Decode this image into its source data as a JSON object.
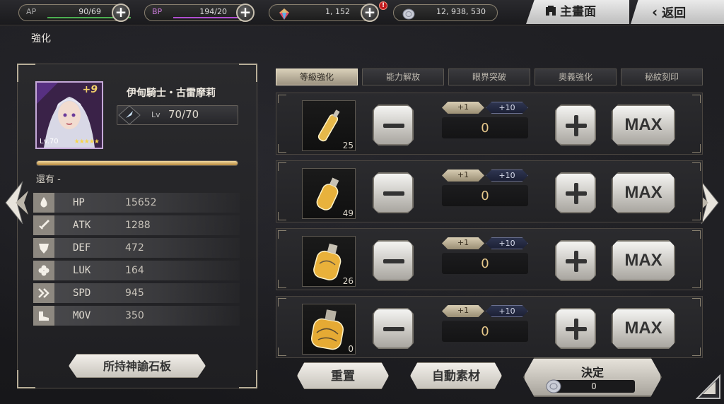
{
  "topbar": {
    "ap": {
      "label": "AP",
      "value": "90/69",
      "fill": 1.0
    },
    "bp": {
      "label": "BP",
      "value": "194/20",
      "fill": 1.0
    },
    "gems": {
      "value": "1, 152",
      "alert": "!"
    },
    "coins": {
      "value": "12, 938, 530"
    },
    "main_menu_label": "主畫面",
    "back_label": "返回"
  },
  "page_title": "強化",
  "unit": {
    "name": "伊甸騎士・古雷摩莉",
    "plus": "+9",
    "portrait_level": "Lv.70",
    "lv_prefix": "Lv",
    "level": "70/70",
    "stars": "★★★★★",
    "exp_fill": 1.0,
    "remain_label": "還有 -",
    "stats": [
      {
        "key": "HP",
        "value": "15652",
        "icon": "drop-icon"
      },
      {
        "key": "ATK",
        "value": "1288",
        "icon": "sword-icon"
      },
      {
        "key": "DEF",
        "value": "472",
        "icon": "shield-icon"
      },
      {
        "key": "LUK",
        "value": "164",
        "icon": "clover-icon"
      },
      {
        "key": "SPD",
        "value": "945",
        "icon": "speed-icon"
      },
      {
        "key": "MOV",
        "value": "350",
        "icon": "boot-icon"
      }
    ],
    "board_button_label": "所持神諭石板"
  },
  "tabs": [
    {
      "label": "等級強化",
      "active": true
    },
    {
      "label": "能力解放",
      "active": false
    },
    {
      "label": "眼界突破",
      "active": false
    },
    {
      "label": "奧義強化",
      "active": false
    },
    {
      "label": "秘紋刻印",
      "active": false
    }
  ],
  "items": [
    {
      "name": "exp-vial-small",
      "count": "25",
      "quantity": "0",
      "step1": "+1",
      "step10": "+10",
      "max_label": "MAX"
    },
    {
      "name": "exp-vial-medium",
      "count": "49",
      "quantity": "0",
      "step1": "+1",
      "step10": "+10",
      "max_label": "MAX"
    },
    {
      "name": "exp-vial-large",
      "count": "26",
      "quantity": "0",
      "step1": "+1",
      "step10": "+10",
      "max_label": "MAX"
    },
    {
      "name": "exp-vial-xlarge",
      "count": "0",
      "quantity": "0",
      "step1": "+1",
      "step10": "+10",
      "max_label": "MAX"
    }
  ],
  "actions": {
    "reset_label": "重置",
    "auto_label": "自動素材",
    "confirm_label": "決定",
    "confirm_cost": "0"
  },
  "colors": {
    "accent_gold": "#e7c98c",
    "ap_bar": "#4caf50",
    "bp_bar": "#b04ed0",
    "portrait_frame": "#c5a9d8"
  }
}
